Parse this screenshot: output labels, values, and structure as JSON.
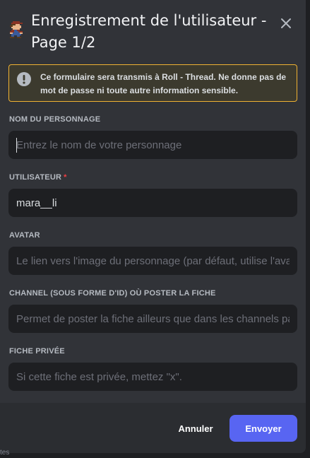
{
  "modal": {
    "title": "Enregistrement de l'utilisateur - Page 1/2",
    "close_icon": "close-icon",
    "app_icon": "mario-pixel-icon"
  },
  "notice": {
    "icon": "exclamation-circle-icon",
    "text": "Ce formulaire sera transmis à Roll - Thread. Ne donne pas de mot de passe ni toute autre information sensible.",
    "border_color": "#f0b232"
  },
  "fields": [
    {
      "label": "NOM DU PERSONNAGE",
      "required": false,
      "value": "",
      "placeholder": "Entrez le nom de votre personnage"
    },
    {
      "label": "UTILISATEUR",
      "required": true,
      "required_mark": "*",
      "value": "mara__li",
      "placeholder": ""
    },
    {
      "label": "AVATAR",
      "required": false,
      "value": "",
      "placeholder": "Le lien vers l'image du personnage (par défaut, utilise l'avatar du joueur)"
    },
    {
      "label": "CHANNEL (SOUS FORME D'ID) OÙ POSTER LA FICHE",
      "required": false,
      "value": "",
      "placeholder": "Permet de poster la fiche ailleurs que dans les channels par défaut"
    },
    {
      "label": "FICHE PRIVÉE",
      "required": false,
      "value": "",
      "placeholder": "Si cette fiche est privée, mettez \"x\"."
    }
  ],
  "footer": {
    "cancel_label": "Annuler",
    "submit_label": "Envoyer",
    "submit_color": "#5865f2"
  },
  "background": {
    "fragment_text": "tes"
  }
}
